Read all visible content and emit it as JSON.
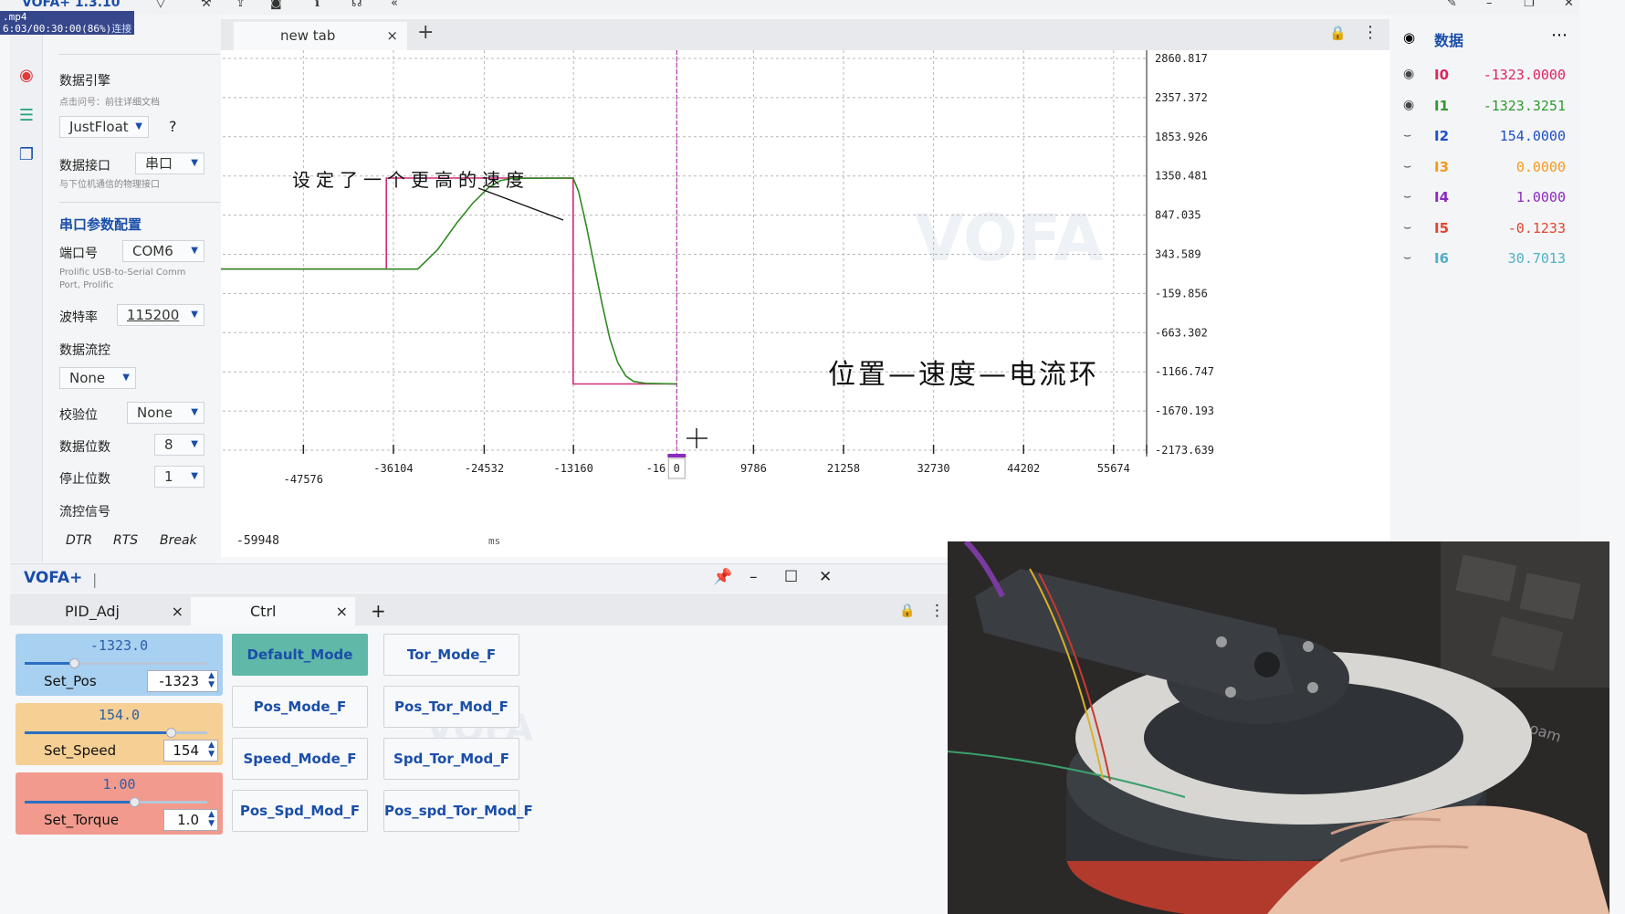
{
  "window": {
    "title": "VOFA+ 1.3.10",
    "overlay_text": "6:03/00:30:00(86%)",
    "overlay_file": ".mp4",
    "connect_label": "连接"
  },
  "config": {
    "engine_label": "数据引擎",
    "engine_hint": "点击问号：前往详细文档",
    "engine_value": "JustFloat",
    "help_label": "?",
    "interface_label": "数据接口",
    "interface_value": "串口",
    "interface_hint": "与下位机通信的物理接口",
    "serial_section": "串口参数配置",
    "port_label": "端口号",
    "port_value": "COM6",
    "port_hint_1": "Prolific USB-to-Serial Comm",
    "port_hint_2": "Port, Prolific",
    "baud_label": "波特率",
    "baud_value": "115200",
    "flow_label": "数据流控",
    "flow_value": "None",
    "parity_label": "校验位",
    "parity_value": "None",
    "databits_label": "数据位数",
    "databits_value": "8",
    "stopbits_label": "停止位数",
    "stopbits_value": "1",
    "flowsig_label": "流控信号",
    "dtr": "DTR",
    "rts": "RTS",
    "brk": "Break"
  },
  "plot": {
    "tab_label": "new tab",
    "close_label": "×",
    "add_label": "+",
    "watermark": "VOFA",
    "annotation_1": "设定了一个更高的速度",
    "annotation_2": "位置—速度—电流环",
    "x_unit": "ms",
    "x_start_label": "-59948",
    "cursor_x_label": "0",
    "cursor_neighbor_label": "-16"
  },
  "chart_data": {
    "type": "line",
    "xlim": [
      -59948,
      60000
    ],
    "ylim": [
      -2173.639,
      2860.817
    ],
    "x_ticks": [
      -47576,
      -36104,
      -24532,
      -13160,
      9786,
      21258,
      32730,
      44202,
      55674
    ],
    "x_tick_labels_top_row": [
      "-36104",
      "-24532",
      "-13160",
      "9786",
      "21258",
      "32730",
      "44202",
      "55674"
    ],
    "x_tick_labels_bottom_row": [
      "-47576"
    ],
    "y_ticks": [
      2860.817,
      2357.372,
      1853.926,
      1350.481,
      847.035,
      343.589,
      -159.856,
      -663.302,
      -1166.747,
      -1670.193,
      -2173.639
    ],
    "series": [
      {
        "color": "#d42a7a",
        "points": [
          [
            -59948,
            154
          ],
          [
            -37000,
            154
          ],
          [
            -37000,
            1323
          ],
          [
            -13200,
            1323
          ],
          [
            -13200,
            -1323
          ],
          [
            0,
            -1323
          ]
        ]
      },
      {
        "color": "#2f8a22",
        "points": [
          [
            -59948,
            154
          ],
          [
            -33000,
            154
          ],
          [
            -30500,
            400
          ],
          [
            -28000,
            750
          ],
          [
            -26000,
            1000
          ],
          [
            -24000,
            1200
          ],
          [
            -22500,
            1290
          ],
          [
            -21000,
            1320
          ],
          [
            -13200,
            1323
          ],
          [
            -12500,
            1150
          ],
          [
            -11500,
            700
          ],
          [
            -10500,
            200
          ],
          [
            -9500,
            -300
          ],
          [
            -8500,
            -750
          ],
          [
            -7500,
            -1050
          ],
          [
            -6500,
            -1220
          ],
          [
            -5500,
            -1290
          ],
          [
            -4000,
            -1315
          ],
          [
            0,
            -1323
          ]
        ]
      }
    ]
  },
  "data_panel": {
    "title": "数据",
    "channels": [
      {
        "name": "I0",
        "value": "-1323.0000",
        "color": "#e0245e",
        "visible": true
      },
      {
        "name": "I1",
        "value": "-1323.3251",
        "color": "#2f9a2f",
        "visible": true
      },
      {
        "name": "I2",
        "value": "154.0000",
        "color": "#1f4fc4",
        "visible": false
      },
      {
        "name": "I3",
        "value": "0.0000",
        "color": "#f29a1e",
        "visible": false
      },
      {
        "name": "I4",
        "value": "1.0000",
        "color": "#8a2bbf",
        "visible": false
      },
      {
        "name": "I5",
        "value": "-0.1233",
        "color": "#e0462e",
        "visible": false
      },
      {
        "name": "I6",
        "value": "30.7013",
        "color": "#4fb0c6",
        "visible": false
      }
    ]
  },
  "bottom": {
    "title": "VOFA+",
    "sep": "|",
    "tab1": "PID_Adj",
    "tab2": "Ctrl",
    "close_label": "×",
    "add_label": "+",
    "watermark": "VOFA",
    "sliders": [
      {
        "value_text": "-1323.0",
        "label": "Set_Pos",
        "spin": "-1323",
        "bg": "#a8d0f0",
        "fill": "#2a6fc2",
        "level": 0.27
      },
      {
        "value_text": "154.0",
        "label": "Set_Speed",
        "spin": "154",
        "bg": "#f5cf93",
        "fill": "#2a6fc2",
        "level": 0.8
      },
      {
        "value_text": "1.00",
        "label": "Set_Torque",
        "spin": "1.0",
        "bg": "#f29a8e",
        "fill": "#2a6fc2",
        "level": 0.6
      }
    ],
    "buttons": [
      {
        "label": "Default_Mode",
        "active": true
      },
      {
        "label": "Tor_Mode_F",
        "active": false
      },
      {
        "label": "Pos_Mode_F",
        "active": false
      },
      {
        "label": "Pos_Tor_Mod_F",
        "active": false
      },
      {
        "label": "Speed_Mode_F",
        "active": false
      },
      {
        "label": "Spd_Tor_Mod_F",
        "active": false
      },
      {
        "label": "Pos_Spd_Mod_F",
        "active": false
      },
      {
        "label": "Pos_spd_Tor_Mod_F",
        "active": false
      }
    ]
  },
  "camera": {
    "keyboard_brand": "wooam"
  }
}
